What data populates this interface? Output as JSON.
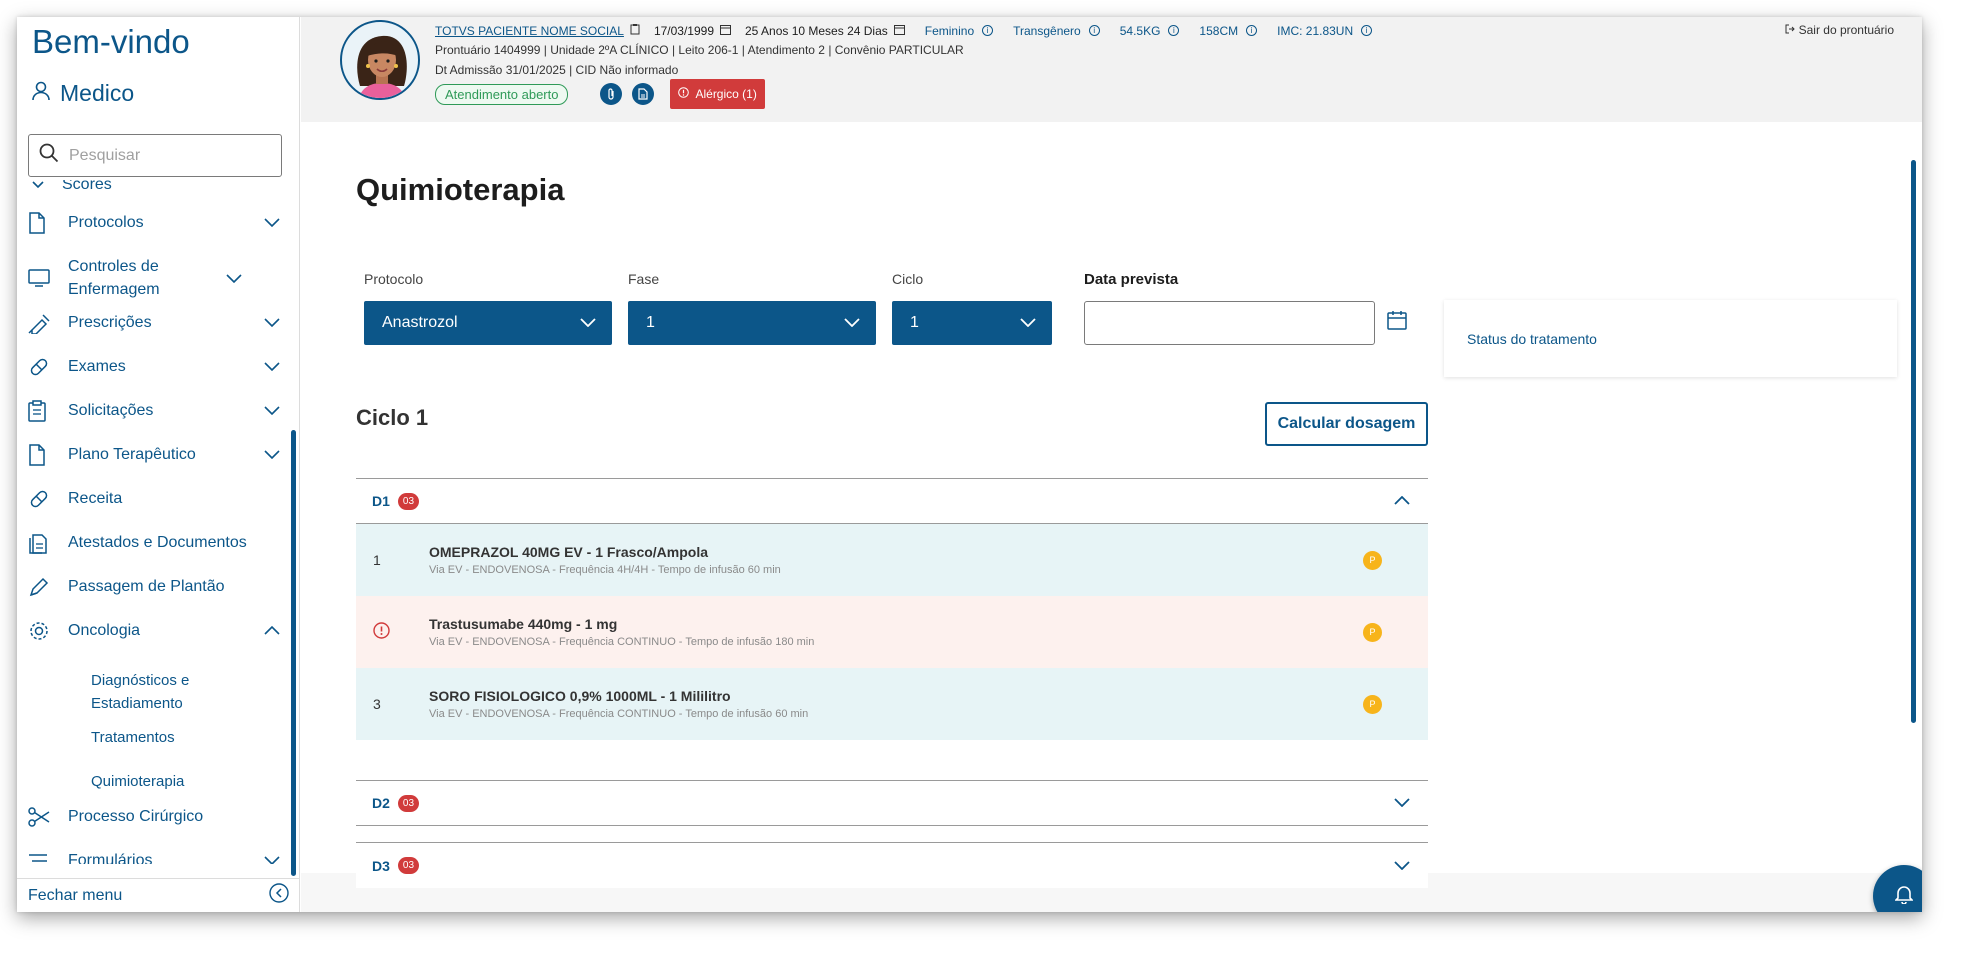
{
  "sidebar": {
    "welcome": "Bem-vindo",
    "user": "Medico",
    "search_placeholder": "Pesquisar",
    "scores": "Scores",
    "items": [
      {
        "label": "Protocolos",
        "icon": "document-icon",
        "expanded": false
      },
      {
        "label": "Controles de Enfermagem",
        "icon": "monitor-icon",
        "expanded": false
      },
      {
        "label": "Prescrições",
        "icon": "syringe-icon",
        "expanded": false
      },
      {
        "label": "Exames",
        "icon": "pill-icon",
        "expanded": false
      },
      {
        "label": "Solicitações",
        "icon": "clipboard-icon",
        "expanded": false
      },
      {
        "label": "Plano Terapêutico",
        "icon": "document-icon",
        "expanded": false
      },
      {
        "label": "Receita",
        "icon": "pill-icon"
      },
      {
        "label": "Atestados e Documentos",
        "icon": "documents-icon"
      },
      {
        "label": "Passagem de Plantão",
        "icon": "pen-icon"
      },
      {
        "label": "Oncologia",
        "icon": "gear-icon",
        "expanded": true
      },
      {
        "label": "Processo Cirúrgico",
        "icon": "scissors-icon"
      },
      {
        "label": "Formulários",
        "icon": "list-icon",
        "expanded": false
      }
    ],
    "oncologia_sub": [
      "Diagnósticos e Estadiamento",
      "Tratamentos",
      "Quimioterapia"
    ],
    "footer": "Fechar menu"
  },
  "header": {
    "patient_name": "TOTVS PACIENTE NOME SOCIAL",
    "birth_date": "17/03/1999",
    "age": "25 Anos 10 Meses 24 Dias",
    "sex": "Feminino",
    "gender": "Transgênero",
    "weight": "54.5KG",
    "height": "158CM",
    "imc": "IMC: 21.83UN",
    "line2": "Prontuário 1404999  |  Unidade 2ºA CLÍNICO  |  Leito 206-1  |  Atendimento 2  |  Convênio PARTICULAR",
    "line3": "Dt Admissão 31/01/2025  |  CID Não informado",
    "status_badge": "Atendimento aberto",
    "allergy": "Alérgico (1)",
    "logout": "Sair do prontuário"
  },
  "main": {
    "title": "Quimioterapia",
    "protocolo_label": "Protocolo",
    "protocolo_value": "Anastrozol",
    "fase_label": "Fase",
    "fase_value": "1",
    "ciclo_label": "Ciclo",
    "ciclo_value": "1",
    "data_prevista_label": "Data prevista",
    "data_prevista_value": "",
    "status_card": "Status do tratamento",
    "ciclo_title": "Ciclo 1",
    "calc_button": "Calcular dosagem",
    "days": [
      {
        "label": "D1",
        "count": "03",
        "expanded": true
      },
      {
        "label": "D2",
        "count": "03",
        "expanded": false
      },
      {
        "label": "D3",
        "count": "03",
        "expanded": false
      }
    ],
    "meds": [
      {
        "num": "1",
        "name": "OMEPRAZOL 40MG EV - 1 Frasco/Ampola",
        "desc": "Via EV - ENDOVENOSA - Frequência 4H/4H - Tempo de infusão 60 min",
        "badge": "P",
        "bg": "#e7f4f6"
      },
      {
        "num": "",
        "name": "Trastusumabe 440mg - 1 mg",
        "desc": "Via EV - ENDOVENOSA - Frequência CONTINUO - Tempo de infusão 180 min",
        "badge": "P",
        "bg": "#fdf1ee"
      },
      {
        "num": "3",
        "name": "SORO FISIOLOGICO 0,9% 1000ML - 1 Mililitro",
        "desc": "Via EV - ENDOVENOSA - Frequência CONTINUO - Tempo de infusão 60 min",
        "badge": "P",
        "bg": "#e7f4f6"
      }
    ]
  },
  "colors": {
    "primary": "#0c5689",
    "alert": "#d13b3b",
    "open": "#2f9a58",
    "pending": "#f7b41b"
  }
}
